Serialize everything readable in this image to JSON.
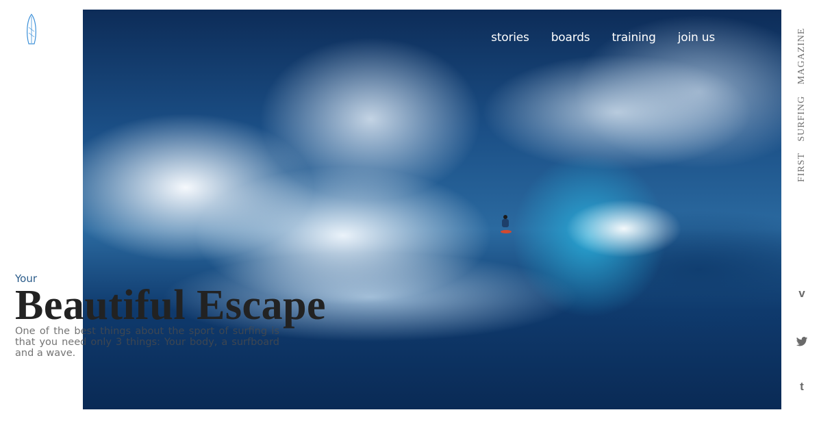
{
  "nav": {
    "items": [
      {
        "label": "stories"
      },
      {
        "label": "boards"
      },
      {
        "label": "training"
      },
      {
        "label": "join us"
      }
    ]
  },
  "side_title": "FIRST SURFING MAGAZINE",
  "hero": {
    "kicker": "Your",
    "headline": "Beautiful Escape",
    "description": "One of the best things about the sport of surfing is that you need only 3 things: Your body, a surfboard and a wave."
  },
  "social": {
    "vimeo": "v",
    "twitter": "twitter-icon",
    "tumblr": "t"
  },
  "colors": {
    "accent": "#2b5c8a",
    "headline": "#222222",
    "side_text": "#6f6f6f"
  }
}
